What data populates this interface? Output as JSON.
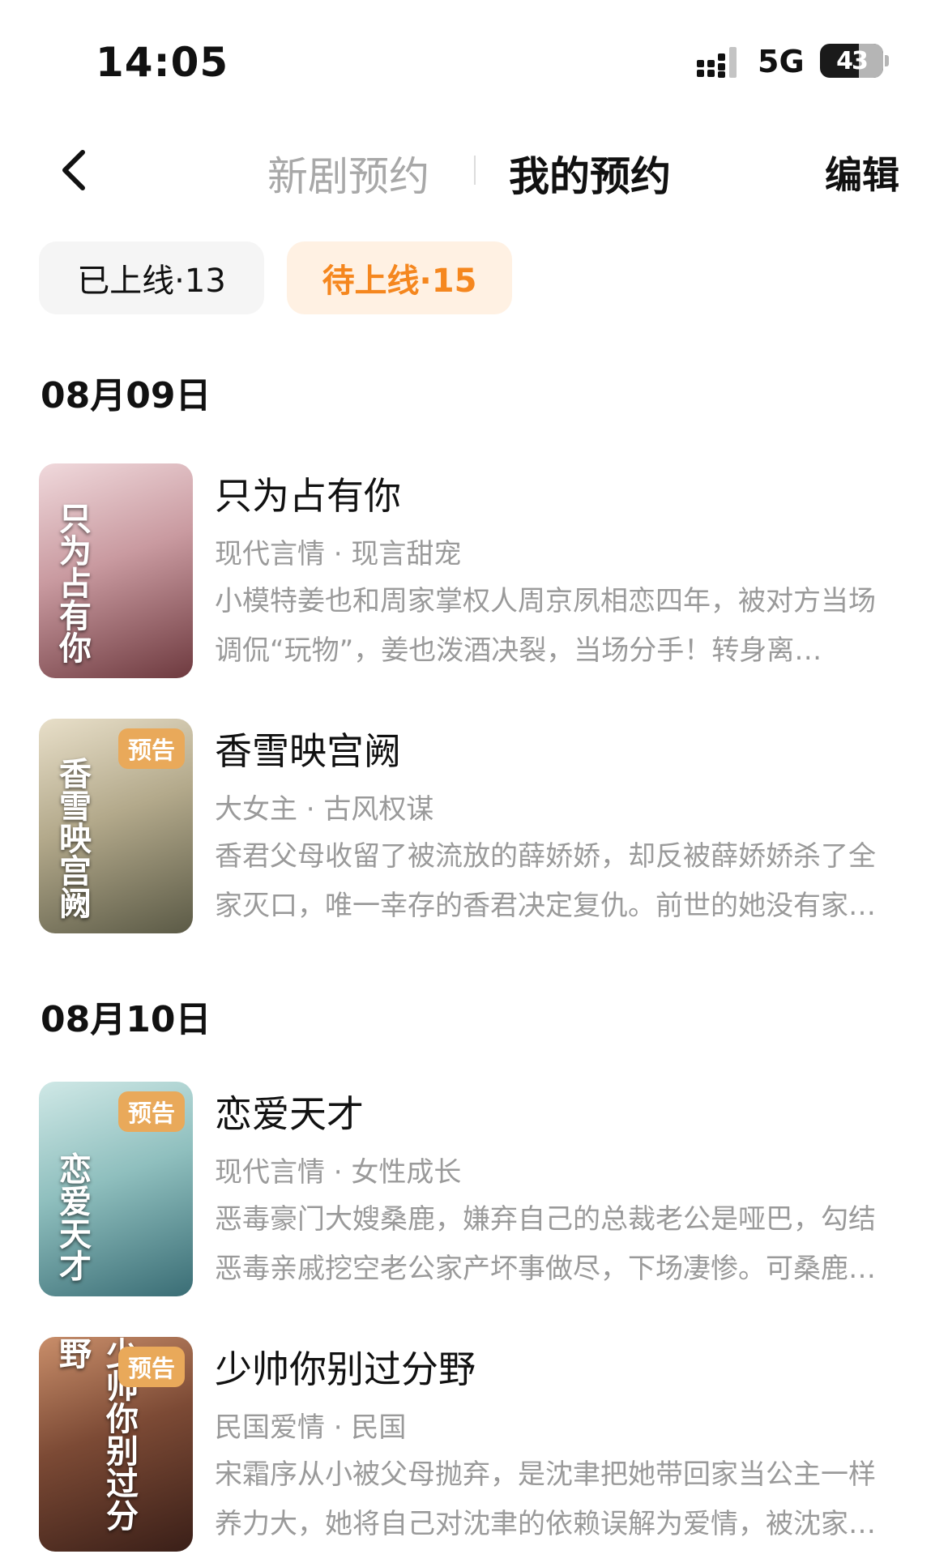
{
  "status_bar": {
    "time": "14:05",
    "network": "5G",
    "battery": "43"
  },
  "nav": {
    "tab_new": "新剧预约",
    "tab_mine": "我的预约",
    "edit": "编辑"
  },
  "filters": {
    "online": "已上线·13",
    "pending": "待上线·15"
  },
  "groups": [
    {
      "date": "08月09日",
      "items": [
        {
          "title": "只为占有你",
          "tags": "现代言情 · 现言甜宠",
          "desc_line1": "小模特姜也和周家掌权人周京夙相恋四年，被对方当场",
          "desc_line2": "调侃“玩物”，姜也泼酒决裂，当场分手！转身离…",
          "badge": "",
          "poster_text": "只为占有你",
          "poster_colors": [
            "#f0d9dc",
            "#6e3a3f"
          ]
        },
        {
          "title": "香雪映宫阙",
          "tags": "大女主 · 古风权谋",
          "desc_line1": "香君父母收留了被流放的薛娇娇，却反被薛娇娇杀了全",
          "desc_line2": "家灭口，唯一幸存的香君决定复仇。前世的她没有家…",
          "badge": "预告",
          "poster_text": "香雪映宫阙",
          "poster_colors": [
            "#e8dfc9",
            "#5b5a46"
          ]
        }
      ]
    },
    {
      "date": "08月10日",
      "items": [
        {
          "title": "恋爱天才",
          "tags": "现代言情 · 女性成长",
          "desc_line1": "恶毒豪门大嫂桑鹿，嫌弃自己的总裁老公是哑巴，勾结",
          "desc_line2": "恶毒亲戚挖空老公家产坏事做尽，下场凄惨。可桑鹿…",
          "badge": "预告",
          "poster_text": "恋爱天才",
          "poster_colors": [
            "#cfe8e6",
            "#3a6d75"
          ]
        },
        {
          "title": "少帅你别过分野",
          "tags": "民国爱情 · 民国",
          "desc_line1": "宋霜序从小被父母抛弃，是沈聿把她带回家当公主一样",
          "desc_line2": "养力大，她将自己对沈聿的依赖误解为爱情，被沈家…",
          "badge": "预告",
          "poster_text": "少帅你别过分野",
          "poster_colors": [
            "#c98e6a",
            "#3a1f18"
          ]
        }
      ]
    }
  ]
}
